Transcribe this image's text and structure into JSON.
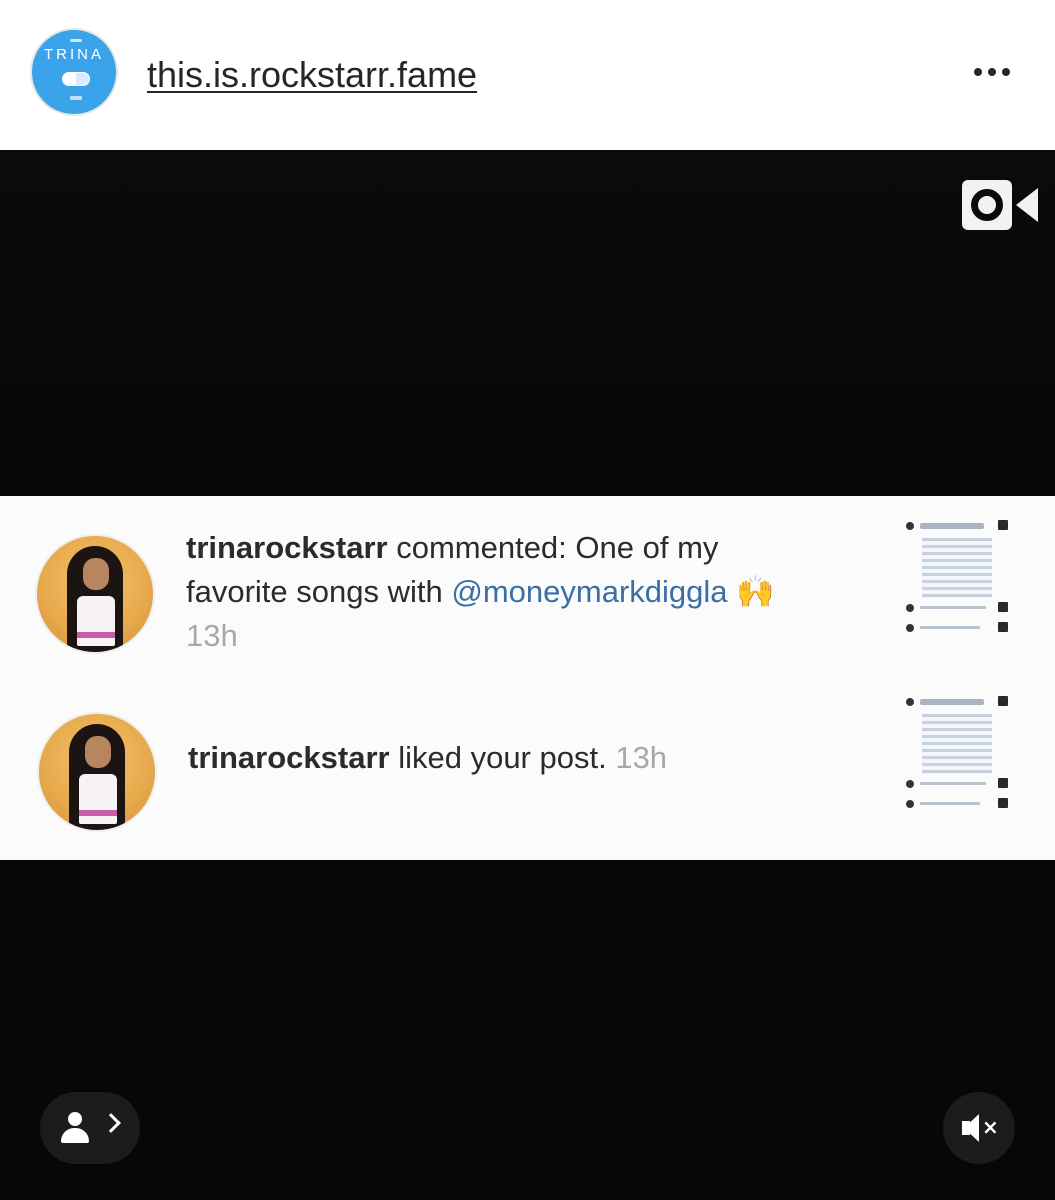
{
  "post": {
    "username": "this.is.rockstarr.fame",
    "avatar_logo_text": "TRINA",
    "more_icon": "more-horizontal-icon"
  },
  "media": {
    "video_icon": "igtv-video-icon",
    "tag_people_icon": "person-icon",
    "mute_icon": "speaker-muted-icon",
    "notifications": [
      {
        "user": "trinarockstarr",
        "line1_rest": " commented: One of my",
        "line2_prefix": "favorite songs with ",
        "mention": "@moneymarkdiggla",
        "emoji": "🙌",
        "time": "13h"
      },
      {
        "user": "trinarockstarr",
        "action": " liked your post.",
        "time": "13h"
      }
    ]
  }
}
